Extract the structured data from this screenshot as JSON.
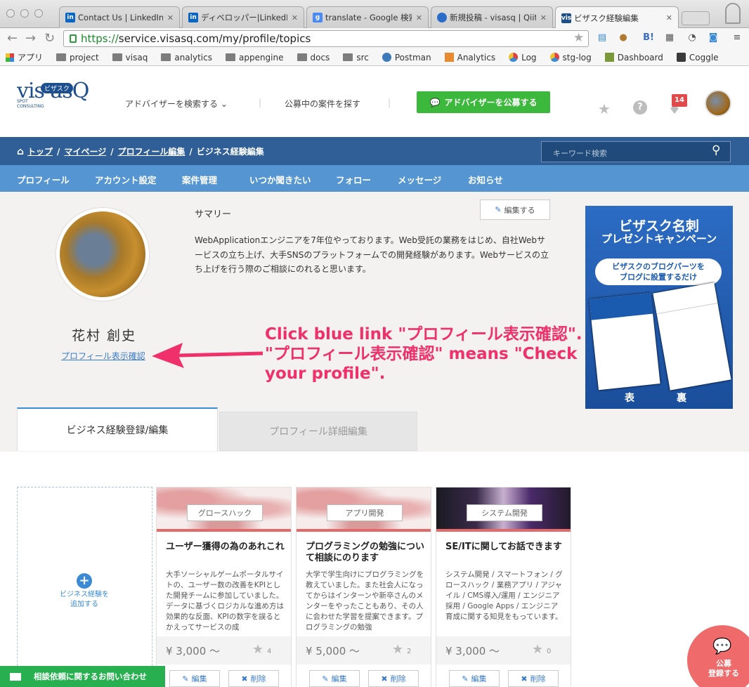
{
  "browser": {
    "tabs": [
      {
        "label": "Contact Us | LinkedIn H",
        "icon": "linkedin-icon"
      },
      {
        "label": "ディベロッパー|LinkedIn",
        "icon": "linkedin-icon"
      },
      {
        "label": "translate - Google 検索",
        "icon": "google-icon"
      },
      {
        "label": "新規投稿 - visasq | Qiita",
        "icon": "qiita-icon"
      },
      {
        "label": "ビザスク経験編集",
        "icon": "visasq-icon"
      }
    ],
    "url_scheme": "https://",
    "url_rest": "service.visasq.com/my/profile/topics",
    "bookmarks": [
      "アプリ",
      "project",
      "visaq",
      "analytics",
      "appengine",
      "docs",
      "src",
      "Postman",
      "Analytics",
      "Log",
      "stg-log",
      "Dashboard",
      "Coggle"
    ]
  },
  "header": {
    "logo": "vis asQ",
    "logo_badge": "ビザスク",
    "logo_sub": "SPOT\nCONSULTING",
    "nav_search": "アドバイザーを検索する ⌄",
    "nav_cases": "公募中の案件を探す",
    "cta": "アドバイザーを公募する",
    "notification_count": "14"
  },
  "breadcrumb": {
    "home": "トップ",
    "mypage": "マイページ",
    "profile_edit": "プロフィール編集",
    "current": "ビジネス経験編集"
  },
  "search": {
    "placeholder": "キーワード検索"
  },
  "menu": [
    "プロフィール",
    "アカウント設定",
    "案件管理",
    "いつか聞きたい",
    "フォロー",
    "メッセージ",
    "お知らせ"
  ],
  "profile": {
    "name": "花村 創史",
    "link": "プロフィール表示確認",
    "summary_label": "サマリー",
    "edit_label": "編集する",
    "summary_text": "WebApplicationエンジニアを7年位やっております。Web受託の業務をはじめ、自社Webサービスの立ち上げ、大手SNSのプラットフォームでの開発経験があります。Webサービスの立ち上げを行う際のご相談にのれると思います。"
  },
  "ad": {
    "title1": "ビザスク名刺",
    "title2": "プレゼントキャンペーン",
    "bubble": "ビザスクのブログパーツを\nブログに設置するだけ",
    "front": "表",
    "back": "裏"
  },
  "annotation": "Click blue link \"プロフィール表示確認\".\n\"プロフィール表示確認\" means \"Check\nyour profile\".",
  "tabs": {
    "active": "ビジネス経験登録/編集",
    "inactive": "プロフィール詳細編集"
  },
  "add_card": "ビジネス経験を\n追加する",
  "cards": [
    {
      "tag": "グロースハック",
      "title": "ユーザー獲得の為のあれこれ",
      "desc": "大手ソーシャルゲームポータルサイトの、ユーザー数の改善をKPIとした開発チームに参加していました。データに基づくロジカルな進め方は効果的な反面、KPIの数字を誤るとかえってサービスの成",
      "price": "¥ 3,000 〜",
      "stars": "4",
      "edit": "編集",
      "del": "削除"
    },
    {
      "tag": "アプリ開発",
      "title": "プログラミングの勉強について相談にのります",
      "desc": "大学で学生向けにプログラミングを教えていました。また社会人になってからはインターンや新卒さんのメンターをやったこともあり、その人に会わせた学習を提案できます。プログラミングの勉強",
      "price": "¥ 5,000 〜",
      "stars": "2",
      "edit": "編集",
      "del": "削除"
    },
    {
      "tag": "システム開発",
      "title": "SE/ITに関してお話できます",
      "desc": "システム開発 / スマートフォン / グロースハック / 業務アプリ / アジャイル / CMS導入/運用 / エンジニア採用 / Google Apps / エンジニア育成に関する知見をもっています。",
      "price": "¥ 3,000 〜",
      "stars": "0",
      "edit": "編集",
      "del": "削除"
    }
  ],
  "footer": {
    "contact": "相談依頼に関するお問い合わせ",
    "bubble": "公募\n登録する"
  }
}
